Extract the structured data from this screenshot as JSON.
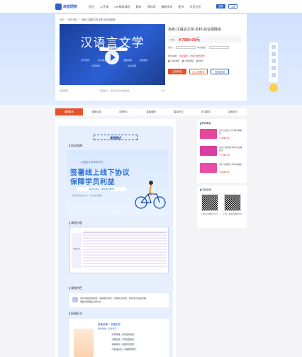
{
  "header": {
    "logo": "启宏网校",
    "nav": [
      "首页",
      "公开课",
      "VIP辅导课程",
      "题库",
      "资料库",
      "最新资讯",
      "图书",
      "学员专区"
    ],
    "login": "登录",
    "register": "注册"
  },
  "breadcrumb": [
    "首页",
    "辅导课程",
    "自考-汉语言文学-本科-协议保障班"
  ],
  "video": {
    "title": "汉语言文学",
    "subtitle": "自考本科",
    "tags": [
      "历年真题",
      "考点串讲",
      "课程讲解",
      "全程答疑",
      "名师授课",
      "协议保障"
    ],
    "collect": "收藏课程",
    "share": "分享",
    "hint": "温馨提示：免费试听请点击播放"
  },
  "product": {
    "title": "自考-汉语言文学-本科-协议保障班",
    "price_label": "价格：",
    "price": "￥7980.00元",
    "opt1_label": "省份：",
    "opt2_label": "考试地区：",
    "service_label": "服务说明：",
    "service_text": "协议保障，未通过免费重学",
    "check1": "直播课程",
    "check2": "录播课程",
    "check3": "教材",
    "buy": "立即报名",
    "cart": "加入购物车",
    "consult": "在线咨询"
  },
  "tabs": [
    "课程概述",
    "课程目录",
    "试题练习",
    "直播课程",
    "模拟考试",
    "学习服务",
    "课程评价"
  ],
  "content": {
    "banner": "课程概述",
    "sec1": "协议保障",
    "promo_top": "汉语言文学本科专业",
    "promo_l1": "签署线上线下协议",
    "promo_l2": "保障学员利益",
    "promo_pill": "考试未通过，明年免费重学",
    "promo_foot": "学员满意度达99%，官方协议保障",
    "sec2": "课程内容",
    "table_cap": "课程安排",
    "sec3": "课程特色",
    "feat1": "名师全程直播授课，讲解重点难点，梳理知识框架，帮助学员快速掌握",
    "feat2": "课程内容覆盖全部考点",
    "sec4": "授课形式",
    "mode_head": "直播授课 + 录播回放",
    "mode_sub": "随时随地 · 反复学习",
    "mode_items": [
      "名师直播，实时互动答疑",
      "录播回放，不限次数观看",
      "题库练习，巩固学习效果",
      "专属班主任，全程督学服务"
    ]
  },
  "sidebar": {
    "recommend_title": "猜你喜欢",
    "items": [
      {
        "title": "自考-汉语言文学-本科-精讲班",
        "price": "￥3980.00",
        "color": "#e5479a"
      },
      {
        "title": "自考-行政管理-本科-协议保障班",
        "price": "￥7980.00",
        "color": "#d93fa0"
      },
      {
        "title": "自考-学前教育-本科-精讲班",
        "price": "￥3980.00",
        "color": "#e84ea5"
      }
    ],
    "qr_title": "扫码咨询",
    "qr1": "扫码关注微信公众号",
    "qr2": "扫码下载启宏网校APP"
  }
}
